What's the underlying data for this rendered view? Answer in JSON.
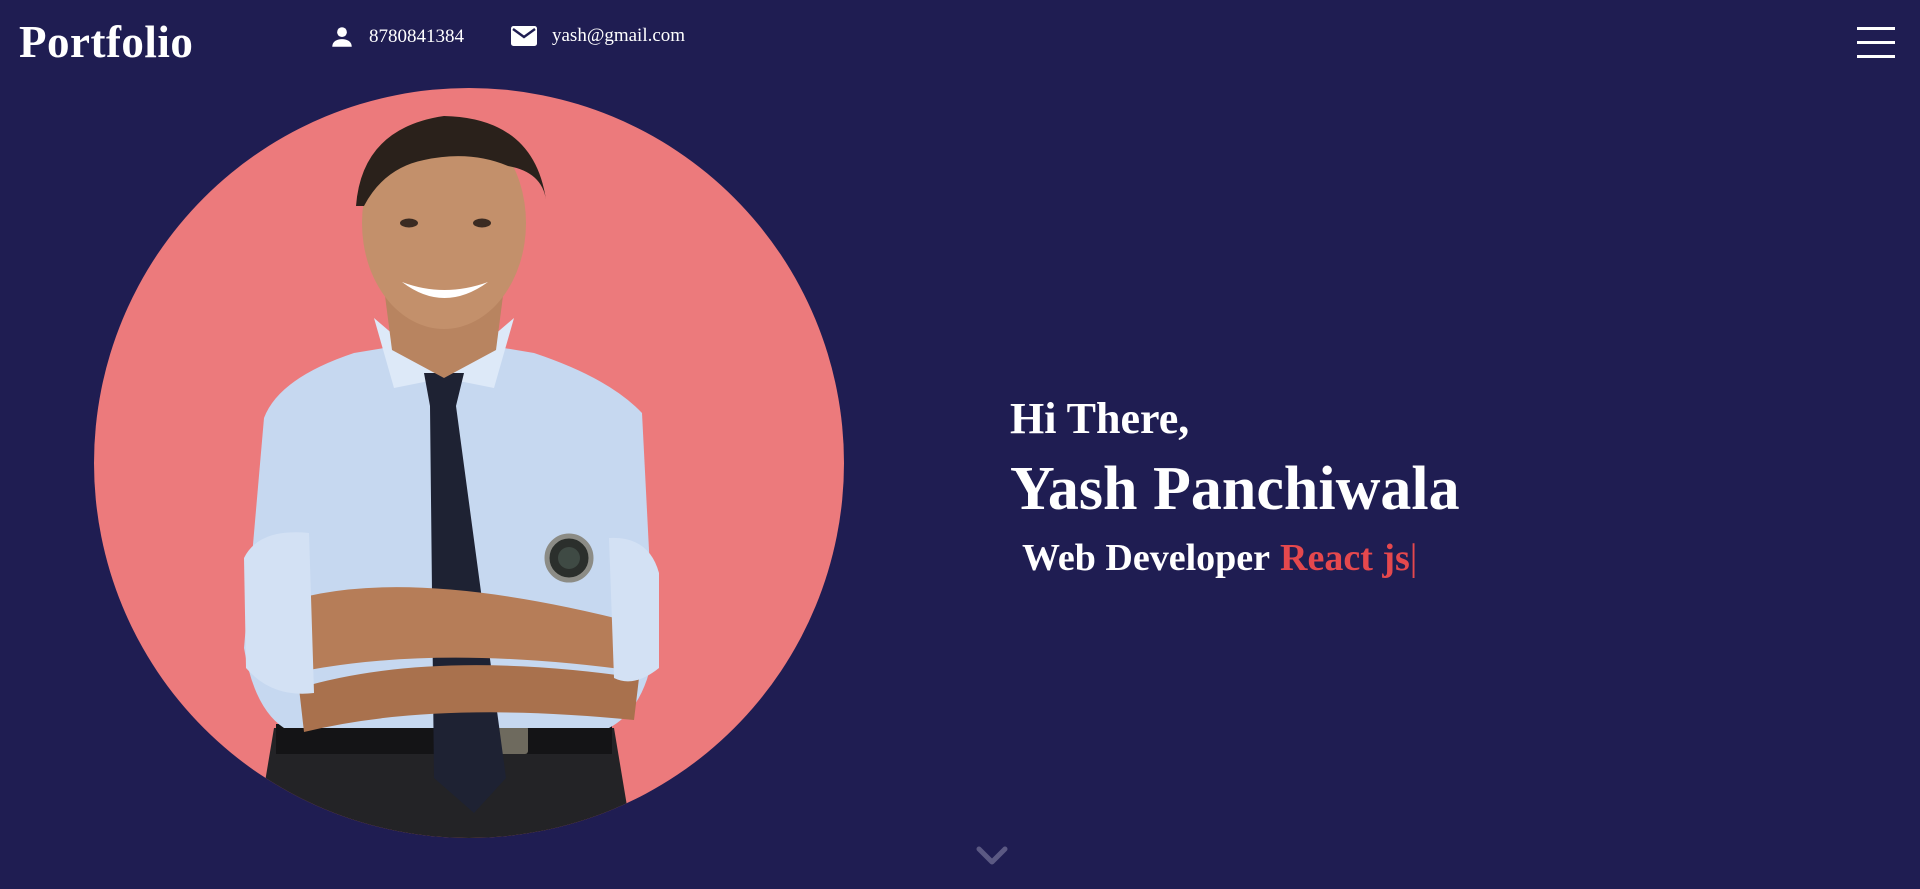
{
  "header": {
    "brand": "Portfolio",
    "phone": "8780841384",
    "email": "yash@gmail.com",
    "phone_icon": "person-icon",
    "email_icon": "mail-icon",
    "menu_icon": "hamburger-menu-icon"
  },
  "hero": {
    "greeting": "Hi There,",
    "name": "Yash Panchiwala",
    "role_static": "Web Developer",
    "role_typed": "React js",
    "cursor": "|",
    "photo_description": "smiling man in light blue shirt and dark tie with arms crossed",
    "scroll_icon": "chevron-down-icon"
  },
  "colors": {
    "background": "#1f1d52",
    "accent": "#e5484d",
    "photo_circle": "#ec7a7c",
    "text": "#ffffff"
  }
}
